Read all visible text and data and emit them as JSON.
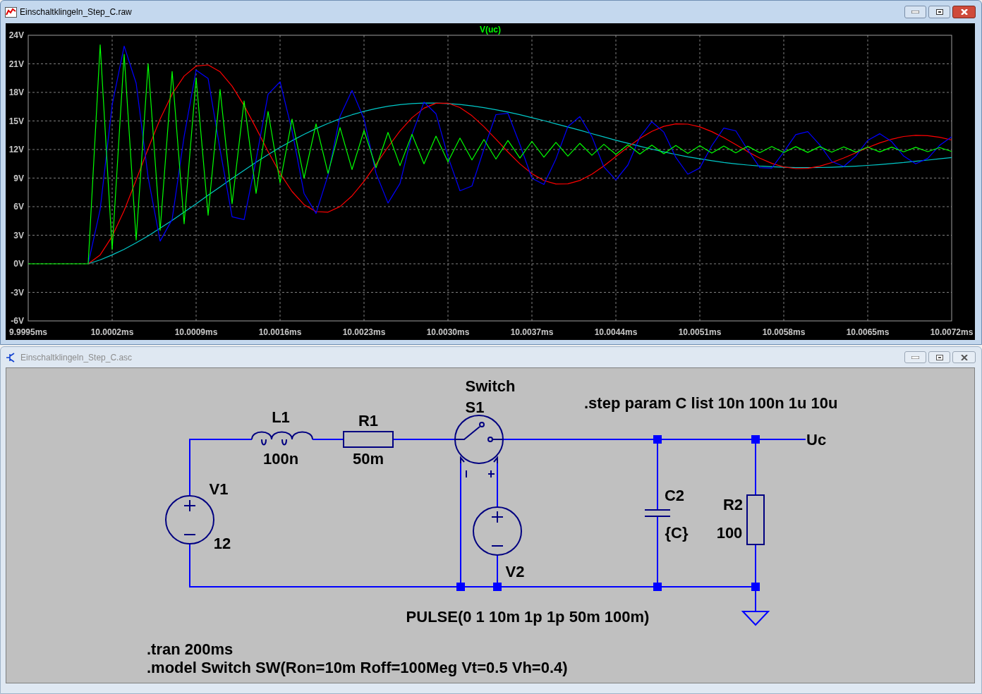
{
  "plot_window": {
    "title": "Einschaltklingeln_Step_C.raw",
    "chart_data": {
      "type": "line",
      "title": "V(uc)",
      "grid": true,
      "xlim": [
        9.9995,
        10.0072
      ],
      "ylim": [
        -6,
        24
      ],
      "xticks": [
        {
          "value": 9.9995,
          "label": "9.9995ms"
        },
        {
          "value": 10.0002,
          "label": "10.0002ms"
        },
        {
          "value": 10.0009,
          "label": "10.0009ms"
        },
        {
          "value": 10.0016,
          "label": "10.0016ms"
        },
        {
          "value": 10.0023,
          "label": "10.0023ms"
        },
        {
          "value": 10.003,
          "label": "10.0030ms"
        },
        {
          "value": 10.0037,
          "label": "10.0037ms"
        },
        {
          "value": 10.0044,
          "label": "10.0044ms"
        },
        {
          "value": 10.0051,
          "label": "10.0051ms"
        },
        {
          "value": 10.0058,
          "label": "10.0058ms"
        },
        {
          "value": 10.0065,
          "label": "10.0065ms"
        },
        {
          "value": 10.0072,
          "label": "10.0072ms"
        }
      ],
      "yticks": [
        {
          "value": 24,
          "label": "24V"
        },
        {
          "value": 21,
          "label": "21V"
        },
        {
          "value": 18,
          "label": "18V"
        },
        {
          "value": 15,
          "label": "15V"
        },
        {
          "value": 12,
          "label": "12V"
        },
        {
          "value": 9,
          "label": "9V"
        },
        {
          "value": 6,
          "label": "6V"
        },
        {
          "value": 3,
          "label": "3V"
        },
        {
          "value": 0,
          "label": "0V"
        },
        {
          "value": -3,
          "label": "-3V"
        },
        {
          "value": -6,
          "label": "-6V"
        }
      ],
      "x": [
        9.9995,
        9.9996,
        9.9997,
        9.9998,
        9.9999,
        10,
        10.0001,
        10.0002,
        10.0003,
        10.0004,
        10.0005,
        10.0006,
        10.0007,
        10.0008,
        10.0009,
        10.001,
        10.0011,
        10.0012,
        10.0013,
        10.0014,
        10.0015,
        10.0016,
        10.0017,
        10.0018,
        10.0019,
        10.002,
        10.0021,
        10.0022,
        10.0023,
        10.0024,
        10.0025,
        10.0026,
        10.0027,
        10.0028,
        10.0029,
        10.003,
        10.0031,
        10.0032,
        10.0033,
        10.0034,
        10.0035,
        10.0036,
        10.0037,
        10.0038,
        10.0039,
        10.004,
        10.0041,
        10.0042,
        10.0043,
        10.0044,
        10.0045,
        10.0046,
        10.0047,
        10.0048,
        10.0049,
        10.005,
        10.0051,
        10.0052,
        10.0053,
        10.0054,
        10.0055,
        10.0056,
        10.0057,
        10.0058,
        10.0059,
        10.006,
        10.0061,
        10.0062,
        10.0063,
        10.0064,
        10.0065,
        10.0066,
        10.0067,
        10.0068,
        10.0069,
        10.007,
        10.0071,
        10.0072
      ],
      "series": [
        {
          "color": "#00c8c8",
          "values": [
            null,
            null,
            null,
            null,
            null,
            0,
            0.41,
            0.93,
            1.52,
            2.2,
            2.93,
            3.73,
            4.56,
            5.42,
            6.3,
            7.2,
            8.08,
            8.97,
            9.82,
            10.66,
            11.46,
            12.22,
            12.93,
            13.59,
            14.19,
            14.74,
            15.23,
            15.65,
            16.01,
            16.3,
            16.54,
            16.71,
            16.83,
            16.88,
            16.88,
            16.83,
            16.73,
            16.58,
            16.4,
            16.18,
            15.93,
            15.65,
            15.35,
            15.04,
            14.7,
            14.36,
            14.02,
            13.67,
            13.32,
            12.98,
            12.66,
            12.34,
            12.04,
            11.75,
            11.48,
            11.24,
            11.02,
            10.82,
            10.64,
            10.5,
            10.37,
            10.27,
            10.19,
            10.13,
            10.1,
            10.1,
            10.11,
            10.14,
            10.19,
            10.25,
            10.33,
            10.42,
            10.53,
            10.64,
            10.77,
            10.89,
            11.02,
            11.16
          ]
        },
        {
          "color": "#ff0000",
          "values": [
            null,
            null,
            null,
            null,
            null,
            0,
            0.93,
            2.88,
            5.59,
            8.79,
            12.09,
            15.21,
            17.82,
            19.71,
            20.76,
            20.89,
            20.16,
            18.66,
            16.62,
            14.25,
            11.79,
            9.5,
            7.59,
            6.21,
            5.48,
            5.42,
            6.01,
            7.13,
            8.66,
            10.43,
            12.26,
            13.95,
            15.34,
            16.34,
            16.86,
            16.87,
            16.41,
            15.55,
            14.4,
            13.08,
            11.74,
            10.49,
            9.47,
            8.74,
            8.38,
            8.4,
            8.75,
            9.41,
            10.28,
            11.25,
            12.25,
            13.17,
            13.91,
            14.44,
            14.7,
            14.67,
            14.38,
            13.88,
            13.24,
            12.51,
            11.77,
            11.1,
            10.55,
            10.17,
            10,
            10.03,
            10.25,
            10.63,
            11.11,
            11.65,
            12.2,
            12.7,
            13.09,
            13.37,
            13.49,
            13.46,
            13.29,
            13
          ]
        },
        {
          "color": "#0000ff",
          "values": [
            null,
            null,
            null,
            null,
            null,
            0,
            5.71,
            16.7,
            22.86,
            18.96,
            9.07,
            2.38,
            4.66,
            13.38,
            20.34,
            19.46,
            11.97,
            4.94,
            4.64,
            10.92,
            17.81,
            19.11,
            13.98,
            7.39,
            5.29,
            9.31,
            15.5,
            18.2,
            15.21,
            9.52,
            6.38,
            8.44,
            13.56,
            16.98,
            15.76,
            11.25,
            7.67,
            8.17,
            12.06,
            15.67,
            15.8,
            12.52,
            8.98,
            8.33,
            11.01,
            14.41,
            15.46,
            13.36,
            10.17,
            8.8,
            10.37,
            13.3,
            14.91,
            13.82,
            11.17,
            9.41,
            10.07,
            12.41,
            14.25,
            13.96,
            11.95,
            10.1,
            10.05,
            11.75,
            13.57,
            13.88,
            12.5,
            10.74,
            10.22,
            11.31,
            12.96,
            13.66,
            12.83,
            11.31,
            10.5,
            11.07,
            12.44,
            13.33
          ]
        },
        {
          "color": "#00ff00",
          "values": [
            0,
            0,
            0,
            0,
            0,
            0,
            23,
            1.5,
            22,
            2.5,
            21,
            3.5,
            20.2,
            4.2,
            19.5,
            5.1,
            18.3,
            6.3,
            17.1,
            7.4,
            16,
            8.5,
            15.2,
            9,
            14.7,
            9.5,
            14.3,
            9.9,
            14,
            10.1,
            13.8,
            10.3,
            13.6,
            10.5,
            13.4,
            10.7,
            13.2,
            10.9,
            13.05,
            11,
            12.95,
            11.1,
            12.85,
            11.2,
            12.75,
            11.3,
            12.65,
            11.4,
            12.55,
            11.5,
            12.5,
            11.52,
            12.46,
            11.56,
            12.42,
            11.6,
            12.4,
            11.62,
            12.36,
            11.65,
            12.34,
            11.67,
            12.32,
            11.69,
            12.3,
            11.7,
            12.3,
            11.72,
            12.28,
            11.73,
            12.26,
            11.75,
            12.25,
            11.76,
            12.23,
            11.78,
            12.21,
            11.8
          ]
        }
      ]
    }
  },
  "schematic_window": {
    "title": "Einschaltklingeln_Step_C.asc",
    "components": [
      {
        "kind": "inductor",
        "name": "L1",
        "value": "100n"
      },
      {
        "kind": "resistor",
        "name": "R1",
        "value": "50m"
      },
      {
        "kind": "switch",
        "model": "Switch",
        "name": "S1"
      },
      {
        "kind": "voltage_source",
        "name": "V1",
        "value": "12"
      },
      {
        "kind": "voltage_source",
        "name": "V2",
        "value": "PULSE(0 1 10m 1p 1p 50m 100m)"
      },
      {
        "kind": "capacitor",
        "name": "C2",
        "value": "{C}"
      },
      {
        "kind": "resistor",
        "name": "R2",
        "value": "100"
      }
    ],
    "net_label": "Uc",
    "directives": [
      ".step param C list 10n 100n 1u 10u",
      ".tran 200ms",
      ".model Switch SW(Ron=10m Roff=100Meg Vt=0.5 Vh=0.4)"
    ]
  }
}
